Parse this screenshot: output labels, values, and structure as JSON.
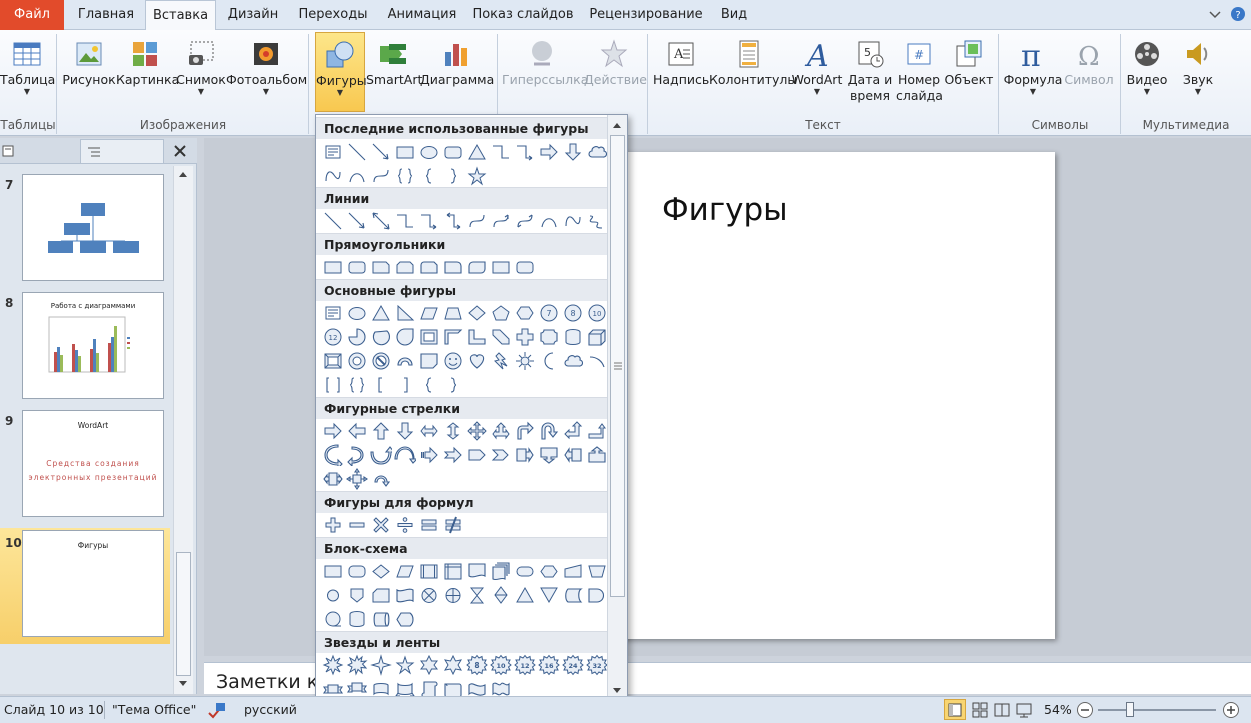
{
  "tabs": [
    "Файл",
    "Главная",
    "Вставка",
    "Дизайн",
    "Переходы",
    "Анимация",
    "Показ слайдов",
    "Рецензирование",
    "Вид"
  ],
  "active_tab": "Вставка",
  "ribbon": {
    "table": "Таблица",
    "picture": "Рисунок",
    "clipart": "Картинка",
    "screenshot": "Снимок",
    "album": "Фотоальбом",
    "shapes": "Фигуры",
    "smartart": "SmartArt",
    "chart": "Диаграмма",
    "hyperlink": "Гиперссылка",
    "action": "Действие",
    "textbox": "Надпись",
    "header": "Колонтитулы",
    "wordart": "WordArt",
    "date1": "Дата и",
    "date2": "время",
    "num1": "Номер",
    "num2": "слайда",
    "object": "Объект",
    "formula": "Формула",
    "symbol": "Символ",
    "video": "Видео",
    "sound": "Звук",
    "g_tables": "Таблицы",
    "g_images": "Изображения",
    "g_text": "Текст",
    "g_symbols": "Символы",
    "g_media": "Мультимедиа"
  },
  "gallery": {
    "recent": "Последние использованные фигуры",
    "lines": "Линии",
    "rects": "Прямоугольники",
    "basic": "Основные фигуры",
    "arrows": "Фигурные стрелки",
    "formula": "Фигуры для формул",
    "flow": "Блок-схема",
    "stars": "Звезды и ленты",
    "badge10": "10",
    "badge12": "12",
    "badge8": "8",
    "badge16": "16",
    "badge24": "24",
    "badge32": "32"
  },
  "slides": [
    {
      "num": "7"
    },
    {
      "num": "8",
      "title": "Работа с диаграммами"
    },
    {
      "num": "9",
      "title": "WordArt",
      "text1": "Средства создания",
      "text2": "электронных презентаций"
    },
    {
      "num": "10",
      "title": "Фигуры"
    }
  ],
  "slide_title": "Фигуры",
  "notes_placeholder": "Заметки к с",
  "status": {
    "slide_info": "Слайд 10 из 10",
    "theme": "\"Тема Office\"",
    "language": "русский",
    "zoom": "54%"
  },
  "colors": {
    "file_tab": "#e24b2b",
    "selected_button": "#f8c850",
    "chart_red": "#c0504d",
    "chart_green": "#9bbb59",
    "chart_blue": "#4f81bd"
  }
}
